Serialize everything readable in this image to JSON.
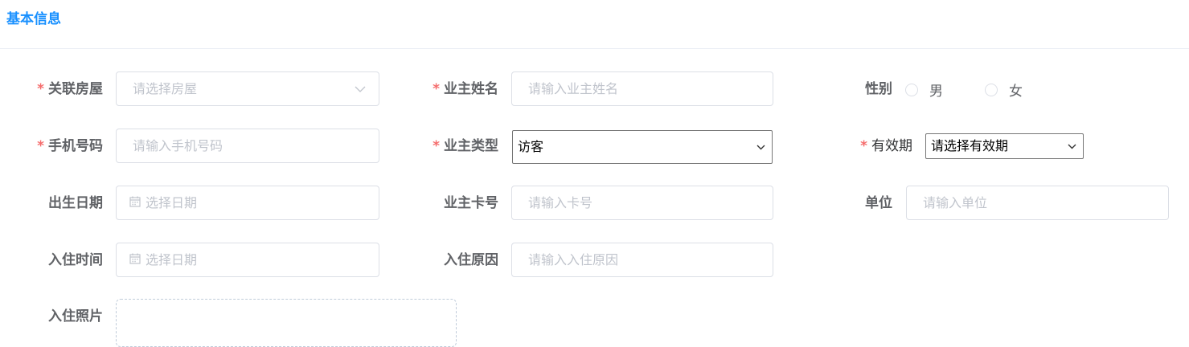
{
  "section": {
    "title": "基本信息"
  },
  "row1": {
    "house": {
      "required": "*",
      "label": "关联房屋",
      "placeholder": "请选择房屋",
      "icon": "chevron-down-icon"
    },
    "owner_name": {
      "required": "*",
      "label": "业主姓名",
      "placeholder": "请输入业主姓名"
    },
    "gender": {
      "label": "性别",
      "options": [
        "男",
        "女"
      ]
    }
  },
  "row2": {
    "phone": {
      "required": "*",
      "label": "手机号码",
      "placeholder": "请输入手机号码"
    },
    "owner_type": {
      "required": "*",
      "label": "业主类型",
      "value": "访客"
    },
    "validity": {
      "required": "*",
      "label": "有效期",
      "value": "请选择有效期"
    }
  },
  "row3": {
    "birth": {
      "label": "出生日期",
      "placeholder": "选择日期",
      "icon": "calendar-icon"
    },
    "card_no": {
      "label": "业主卡号",
      "placeholder": "请输入卡号"
    },
    "unit": {
      "label": "单位",
      "placeholder": "请输入单位"
    }
  },
  "row4": {
    "checkin_time": {
      "label": "入住时间",
      "placeholder": "选择日期",
      "icon": "calendar-icon"
    },
    "checkin_reason": {
      "label": "入住原因",
      "placeholder": "请输入入住原因"
    }
  },
  "row5": {
    "photo": {
      "label": "入住照片"
    }
  }
}
